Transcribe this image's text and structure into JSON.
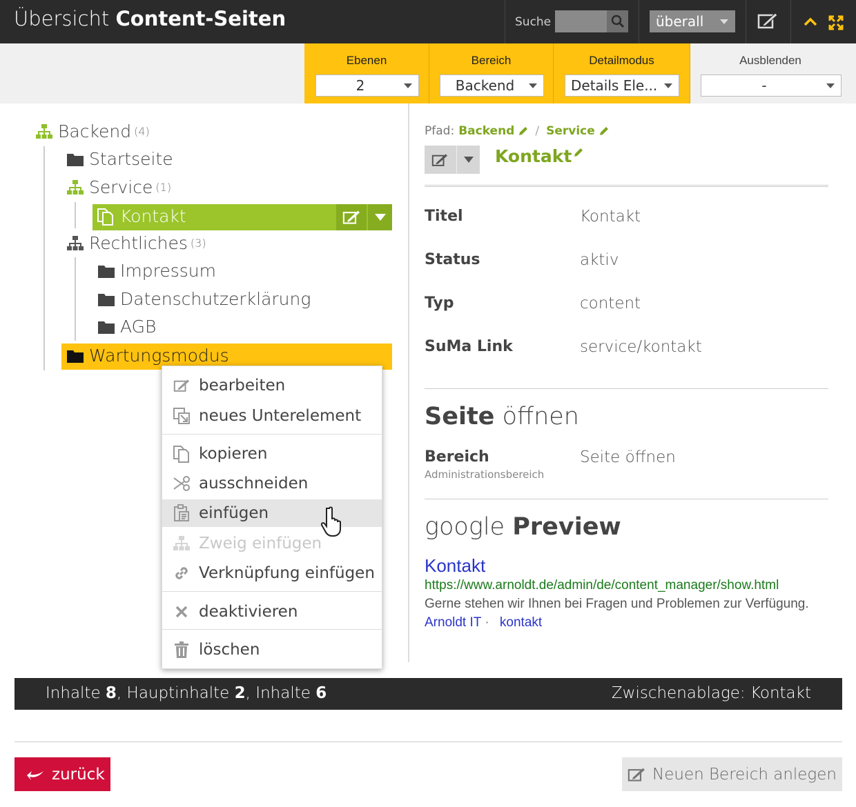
{
  "header": {
    "title_light": "Übersicht",
    "title_bold": "Content-Seiten",
    "search_label": "Suche",
    "search_placeholder": "",
    "scope_value": "überall"
  },
  "filters": {
    "ebenen": {
      "label": "Ebenen",
      "value": "2"
    },
    "bereich": {
      "label": "Bereich",
      "value": "Backend"
    },
    "detailmodus": {
      "label": "Detailmodus",
      "value": "Details Ele..."
    },
    "ausblenden": {
      "label": "Ausblenden",
      "value": "-"
    }
  },
  "tree": {
    "root": {
      "label": "Backend",
      "count": "(4)"
    },
    "startseite": {
      "label": "Startseite"
    },
    "service": {
      "label": "Service",
      "count": "(1)"
    },
    "kontakt": {
      "label": "Kontakt"
    },
    "rechtliches": {
      "label": "Rechtliches",
      "count": "(3)"
    },
    "impressum": {
      "label": "Impressum"
    },
    "datenschutz": {
      "label": "Datenschutzerklärung"
    },
    "agb": {
      "label": "AGB"
    },
    "wartungsmodus": {
      "label": "Wartungsmodus"
    }
  },
  "context_menu": {
    "bearbeiten": "bearbeiten",
    "neues_unterelement": "neues Unterelement",
    "kopieren": "kopieren",
    "ausschneiden": "ausschneiden",
    "einfuegen": "einfügen",
    "zweig_einfuegen": "Zweig einfügen",
    "verknuepfung_einfuegen": "Verknüpfung einfügen",
    "deaktivieren": "deaktivieren",
    "loeschen": "löschen"
  },
  "detail": {
    "path_label": "Pfad:",
    "path_items": [
      "Backend",
      "Service"
    ],
    "path_sep": "/",
    "title": "Kontakt",
    "props": [
      {
        "key": "Titel",
        "value": "Kontakt"
      },
      {
        "key": "Status",
        "value": "aktiv"
      },
      {
        "key": "Typ",
        "value": "content"
      },
      {
        "key": "SuMa Link",
        "value": "service/kontakt"
      }
    ],
    "open_heading_bold": "Seite",
    "open_heading_light": "öffnen",
    "bereich_key": "Bereich",
    "bereich_sub": "Administrationsbereich",
    "bereich_value": "Seite öffnen",
    "preview_heading_light": "google",
    "preview_heading_bold": "Preview",
    "preview": {
      "title": "Kontakt",
      "url": "https://www.arnoldt.de/admin/de/content_manager/show.html",
      "description": "Gerne stehen wir Ihnen bei Fragen und Problemen zur Verfügung.",
      "link1": "Arnoldt IT",
      "dot": "·",
      "link2": "kontakt"
    }
  },
  "status": {
    "inhalte_label": "Inhalte",
    "inhalte_value": "8",
    "haupt_label": "Hauptinhalte",
    "haupt_value": "2",
    "inhalte2_label": "Inhalte",
    "inhalte2_value": "6",
    "clipboard": "Zwischenablage: Kontakt"
  },
  "buttons": {
    "back": "zurück",
    "new_area": "Neuen Bereich anlegen"
  },
  "colors": {
    "accent_yellow": "#ffc20e",
    "accent_green": "#9bc52b",
    "danger_red": "#d0103a",
    "dark": "#2b2b2b"
  }
}
